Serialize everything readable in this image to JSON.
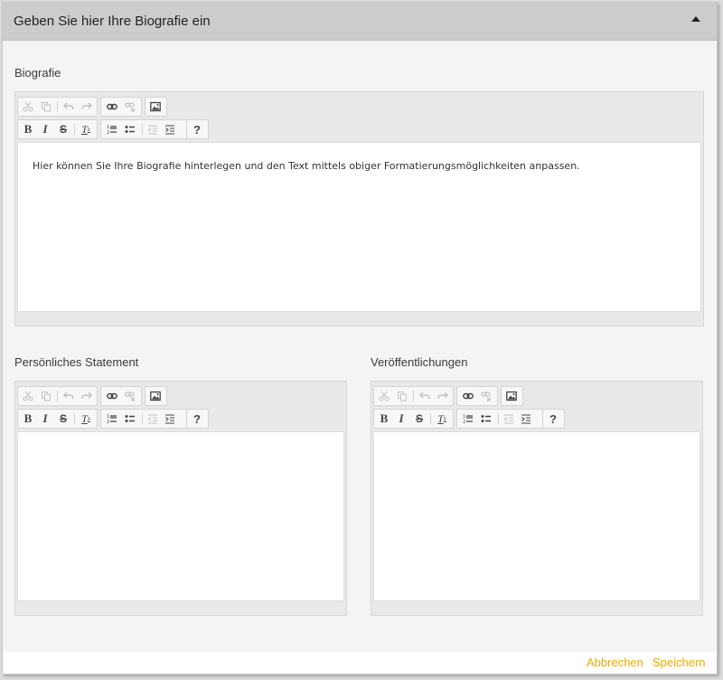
{
  "dialog": {
    "title": "Geben Sie hier Ihre Biografie ein"
  },
  "fields": {
    "biografie": {
      "label": "Biografie",
      "content": "Hier können Sie Ihre Biografie hinterlegen und den Text mittels obiger Formatierungsmöglichkeiten anpassen."
    },
    "statement": {
      "label": "Persönliches Statement",
      "content": ""
    },
    "veroeffentlichungen": {
      "label": "Veröffentlichungen",
      "content": ""
    }
  },
  "toolbar": {
    "row1": [
      "cut",
      "copy",
      "undo",
      "redo",
      "link",
      "unlink",
      "image"
    ],
    "row2": [
      "bold",
      "italic",
      "strikethrough",
      "remove-format",
      "numbered-list",
      "bulleted-list",
      "outdent",
      "indent",
      "help"
    ],
    "glyphs": {
      "bold": "B",
      "italic": "I",
      "strike": "S",
      "clear": "T",
      "clear_sub": "x",
      "help": "?"
    }
  },
  "footer": {
    "cancel_label": "Abbrechen",
    "save_label": "Speichern"
  },
  "colors": {
    "accent": "#f2a900",
    "header_bg": "#cccccc",
    "panel_bg": "#f4f4f4"
  }
}
